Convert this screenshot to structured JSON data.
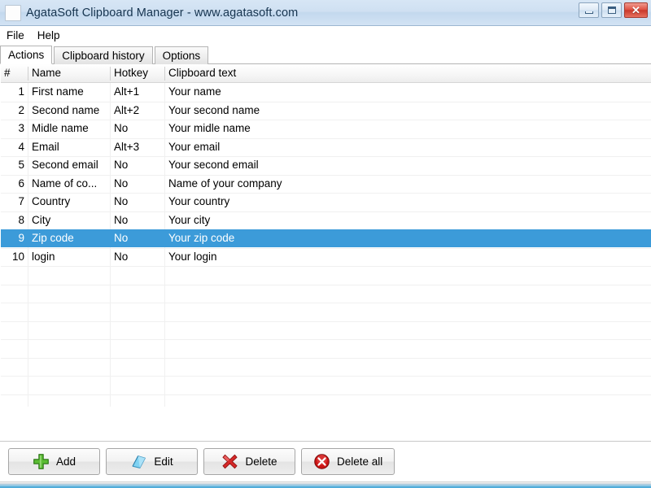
{
  "window": {
    "title": "AgataSoft Clipboard Manager - www.agatasoft.com",
    "icon": "app-icon",
    "controls": {
      "minimize": "minimize-icon",
      "maximize": "maximize-icon",
      "close": "✕"
    }
  },
  "menu": {
    "items": [
      {
        "label": "File"
      },
      {
        "label": "Help"
      }
    ]
  },
  "tabs": [
    {
      "label": "Actions",
      "active": true
    },
    {
      "label": "Clipboard history",
      "active": false
    },
    {
      "label": "Options",
      "active": false
    }
  ],
  "table": {
    "columns": [
      {
        "key": "num",
        "label": "#"
      },
      {
        "key": "name",
        "label": "Name"
      },
      {
        "key": "hotkey",
        "label": "Hotkey"
      },
      {
        "key": "text",
        "label": "Clipboard text"
      }
    ],
    "rows": [
      {
        "num": "1",
        "name": "First name",
        "hotkey": "Alt+1",
        "text": "Your name",
        "selected": false
      },
      {
        "num": "2",
        "name": "Second name",
        "hotkey": "Alt+2",
        "text": "Your second name",
        "selected": false
      },
      {
        "num": "3",
        "name": "Midle name",
        "hotkey": "No",
        "text": "Your midle name",
        "selected": false
      },
      {
        "num": "4",
        "name": "Email",
        "hotkey": "Alt+3",
        "text": "Your email",
        "selected": false
      },
      {
        "num": "5",
        "name": "Second email",
        "hotkey": "No",
        "text": "Your second email",
        "selected": false
      },
      {
        "num": "6",
        "name": "Name of co...",
        "hotkey": "No",
        "text": "Name of your company",
        "selected": false
      },
      {
        "num": "7",
        "name": "Country",
        "hotkey": "No",
        "text": "Your country",
        "selected": false
      },
      {
        "num": "8",
        "name": "City",
        "hotkey": "No",
        "text": "Your city",
        "selected": false
      },
      {
        "num": "9",
        "name": "Zip code",
        "hotkey": "No",
        "text": "Your zip code",
        "selected": true
      },
      {
        "num": "10",
        "name": "login",
        "hotkey": "No",
        "text": "Your login",
        "selected": false
      }
    ],
    "selection_color": "#3c9bd9",
    "row_count": 10
  },
  "buttons": [
    {
      "label": "Add",
      "icon": "green-plus-icon",
      "color": "#4caf2a"
    },
    {
      "label": "Edit",
      "icon": "blue-book-icon",
      "color": "#58b6e8"
    },
    {
      "label": "Delete",
      "icon": "red-cross-icon",
      "color": "#d32020"
    },
    {
      "label": "Delete all",
      "icon": "red-circle-x-icon",
      "color": "#cc1414"
    }
  ]
}
